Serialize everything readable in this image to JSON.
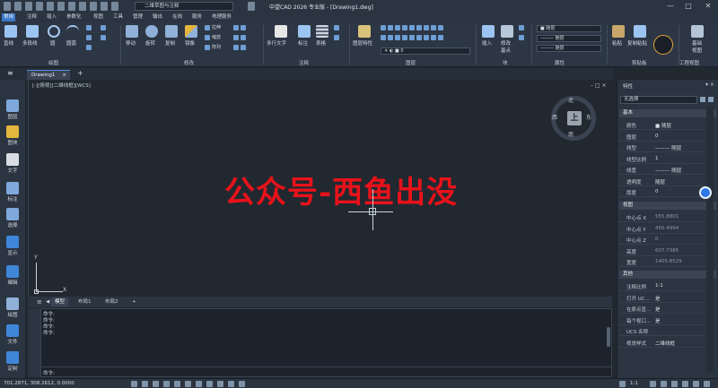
{
  "titlebar": {
    "title": "中望CAD 2026 专业版 - [Drawing1.dwg]",
    "workspace": "二维草图与注释",
    "min": "—",
    "max": "□",
    "close": "✕"
  },
  "menu": [
    "常用",
    "注释",
    "插入",
    "参数化",
    "视图",
    "工具",
    "管理",
    "输出",
    "在线",
    "服务",
    "地理服务"
  ],
  "ribbon": {
    "draw_tools": [
      "直线",
      "多段线",
      "圆",
      "圆弧"
    ],
    "modify_big": [
      "移动",
      "旋转",
      "复制",
      "镜像"
    ],
    "modify_small": [
      "拉伸",
      "缩放",
      "阵列"
    ],
    "annot": [
      "多行文字",
      "标注",
      "表格"
    ],
    "layer_big": "图层特性",
    "layer_value": "0",
    "block_big": "插入",
    "block_edit": "修改",
    "block_edit2": "基点",
    "props_color": "随层",
    "props_linetype": "随层",
    "props_lineweight": "随层",
    "clip": [
      "粘贴",
      "复制粘贴"
    ],
    "ucs": [
      "基础",
      "视图"
    ],
    "panels": [
      "绘图",
      "修改",
      "注释",
      "图层",
      "块",
      "属性",
      "剪贴板",
      "工程视图"
    ]
  },
  "doc_tab": {
    "name": "Drawing1",
    "close": "×",
    "add": "+"
  },
  "left_tools": [
    "图层",
    "图块",
    "文字",
    "标注",
    "选择",
    "显示",
    "编辑",
    "绘图",
    "文件",
    "定制"
  ],
  "canvas": {
    "view_label": "[-][俯视][二维线框][WCS]",
    "watermark": "公众号-西鱼出没",
    "viewcube": {
      "top": "上",
      "n": "北",
      "s": "南",
      "w": "西",
      "e": "东"
    },
    "ucs_x": "X",
    "ucs_y": "Y"
  },
  "layout_tabs": [
    "模型",
    "布局1",
    "布局2",
    "+"
  ],
  "command": {
    "lines": [
      "命令:",
      "命令:",
      "命令:",
      "命令:"
    ],
    "prompt": "命令:"
  },
  "status": {
    "coords": "701.2871, 308.2612, 0.0000",
    "scale": "1:1"
  },
  "properties": {
    "title": "特性",
    "selection": "无选择",
    "sections": {
      "basic": "基本",
      "view": "视图",
      "other": "其他"
    },
    "basic_rows": [
      {
        "k": "颜色",
        "v": "■ 随层"
      },
      {
        "k": "图层",
        "v": "0"
      },
      {
        "k": "线型",
        "v": "——— 随层"
      },
      {
        "k": "线型比例",
        "v": "1"
      },
      {
        "k": "线宽",
        "v": "——— 随层"
      },
      {
        "k": "透明度",
        "v": "随层"
      },
      {
        "k": "厚度",
        "v": "0"
      }
    ],
    "view_rows": [
      {
        "k": "中心点 X",
        "v": "555.8801"
      },
      {
        "k": "中心点 Y",
        "v": "450.4994"
      },
      {
        "k": "中心点 Z",
        "v": "0"
      },
      {
        "k": "高度",
        "v": "607.7385"
      },
      {
        "k": "宽度",
        "v": "1405.8529"
      }
    ],
    "other_rows": [
      {
        "k": "注释比例",
        "v": "1:1"
      },
      {
        "k": "打开 UC...",
        "v": "是"
      },
      {
        "k": "在原点显...",
        "v": "是"
      },
      {
        "k": "每个视口...",
        "v": "是"
      },
      {
        "k": "UCS 名称",
        "v": ""
      },
      {
        "k": "视觉样式",
        "v": "二维线框"
      }
    ]
  }
}
